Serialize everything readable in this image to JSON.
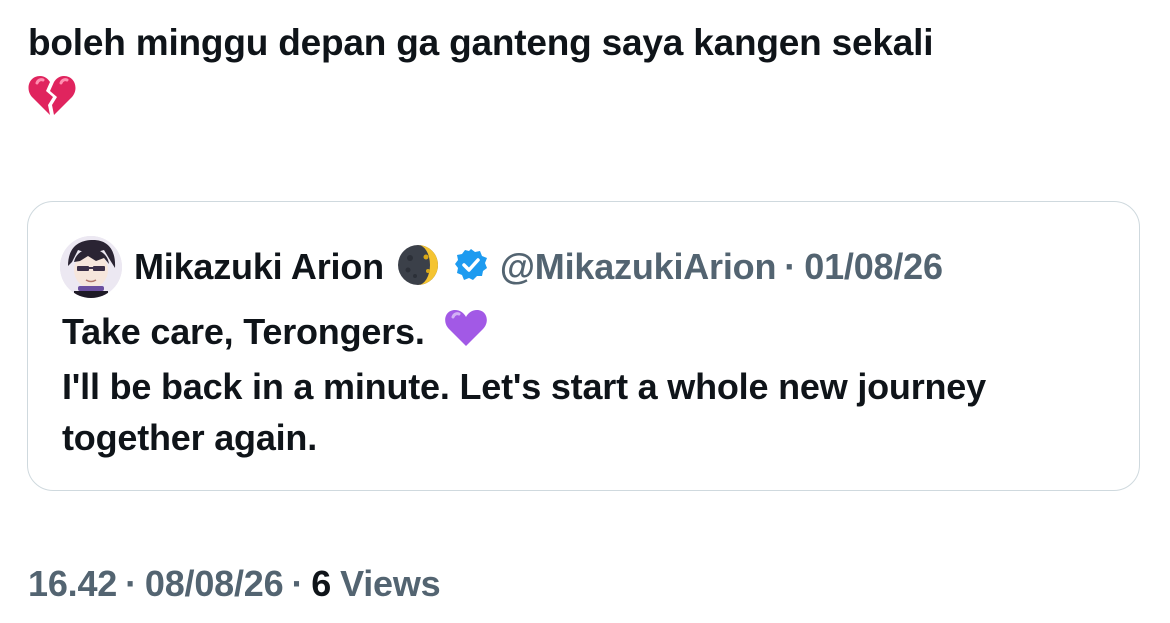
{
  "tweet": {
    "text_line1": "boleh minggu depan ga ganteng saya kangen sekali",
    "emoji": "broken-heart-icon"
  },
  "quote": {
    "name": "Mikazuki Arion",
    "moon_icon": "waxing-crescent-moon-icon",
    "verified_icon": "verified-badge-icon",
    "handle": "@MikazukiArion",
    "separator": "·",
    "date": "01/08/26",
    "body_line1": "Take care, Terongers.",
    "body_emoji": "purple-heart-icon",
    "body_line2": "I'll be back in a minute. Let's start a whole new journey",
    "body_line3": "together again."
  },
  "meta": {
    "time": "16.42",
    "separator": "·",
    "date": "08/08/26",
    "views_count": "6",
    "views_label": "Views"
  },
  "colors": {
    "text": "#0f1419",
    "secondary": "#536471",
    "border": "#cfd9de",
    "verified": "#1d9bf0",
    "purple_heart": "#a259e6",
    "broken_heart": "#e0245e"
  }
}
